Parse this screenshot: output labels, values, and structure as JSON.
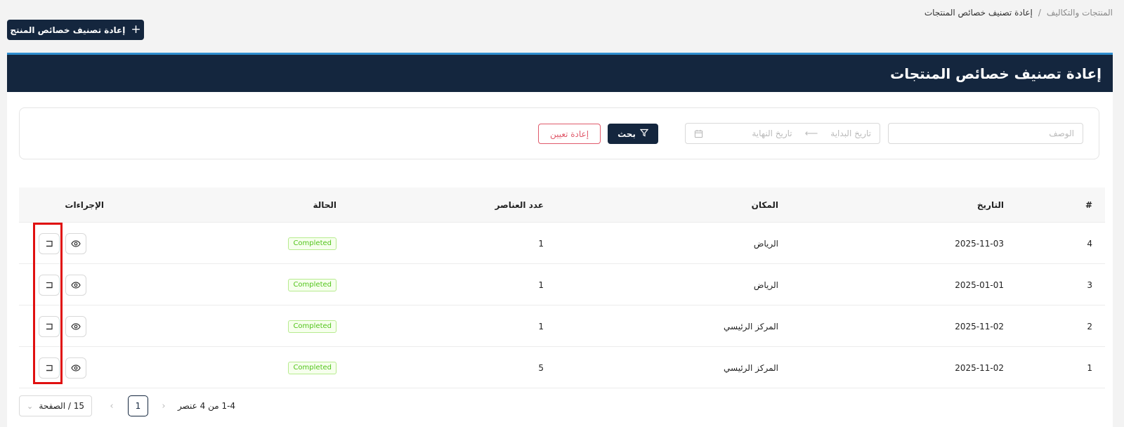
{
  "breadcrumb": {
    "parent": "المنتجات والتكاليف",
    "separator": "/",
    "current": "إعادة تصنيف خصائص المنتجات"
  },
  "toolbar": {
    "add_button_label": "إعادة تصنيف خصائص المنتج",
    "add_icon": "plus-icon"
  },
  "header": {
    "title": "إعادة تصنيف خصائص المنتجات"
  },
  "filters": {
    "description_placeholder": "الوصف",
    "start_date_placeholder": "تاريخ البداية",
    "end_date_placeholder": "تاريخ النهاية",
    "search_label": "بحث",
    "reset_label": "إعادة تعيين"
  },
  "table": {
    "columns": {
      "index": "#",
      "date": "التاريخ",
      "location": "المكان",
      "item_count": "عدد العناصر",
      "status": "الحالة",
      "actions": "الإجراءات"
    },
    "rows": [
      {
        "index": "4",
        "date": "2025-11-03",
        "location": "الرياض",
        "item_count": "1",
        "status": "Completed"
      },
      {
        "index": "3",
        "date": "2025-01-01",
        "location": "الرياض",
        "item_count": "1",
        "status": "Completed"
      },
      {
        "index": "2",
        "date": "2025-11-02",
        "location": "المركز الرئيسي",
        "item_count": "1",
        "status": "Completed"
      },
      {
        "index": "1",
        "date": "2025-11-02",
        "location": "المركز الرئيسي",
        "item_count": "5",
        "status": "Completed"
      }
    ]
  },
  "pagination": {
    "total_text": "1-4 من 4 عنصر",
    "current_page": "1",
    "page_size_label": "15 / الصفحة"
  },
  "colors": {
    "primary": "#14263e",
    "accent_border": "#2f8ecf",
    "danger": "#e05a6b",
    "success": "#52c41a",
    "highlight": "#e01010"
  }
}
